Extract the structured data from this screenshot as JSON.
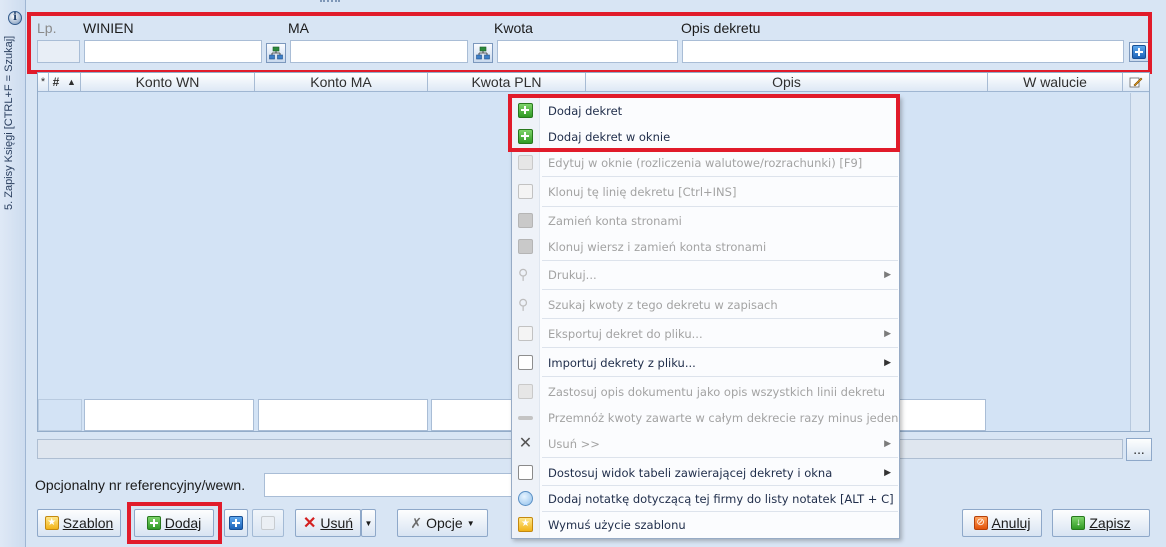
{
  "side_panel": {
    "label": "5. Zapisy Księgi [CTRL+F = Szukaj]"
  },
  "entry_header": {
    "lp_label": "Lp.",
    "winien_label": "WINIEN",
    "ma_label": "MA",
    "kwota_label": "Kwota",
    "opis_label": "Opis dekretu"
  },
  "grid": {
    "columns": [
      "*",
      "#",
      "▲",
      "Konto WN",
      "Konto MA",
      "Kwota PLN",
      "Opis",
      "W walucie"
    ]
  },
  "context_menu": {
    "items": [
      {
        "label": "Dodaj dekret",
        "enabled": true,
        "icon": "plus-green-icon"
      },
      {
        "label": "Dodaj dekret w oknie",
        "enabled": true,
        "icon": "plus-green-icon"
      },
      {
        "label": "Edytuj w oknie (rozliczenia walutowe/rozrachunki) [F9]",
        "enabled": false,
        "icon": "pencil-icon"
      },
      {
        "label": "Klonuj tę linię dekretu [Ctrl+INS]",
        "enabled": false,
        "icon": "clone-icon"
      },
      {
        "label": "Zamień konta stronami",
        "enabled": false,
        "icon": "swap-icon"
      },
      {
        "label": "Klonuj wiersz i zamień konta stronami",
        "enabled": false,
        "icon": "swap-icon"
      },
      {
        "label": "Drukuj...",
        "enabled": false,
        "icon": "magnifier-icon",
        "submenu": true
      },
      {
        "label": "Szukaj kwoty z tego dekretu w zapisach",
        "enabled": false,
        "icon": "magnifier-icon"
      },
      {
        "label": "Eksportuj dekret do pliku...",
        "enabled": false,
        "icon": "export-icon",
        "submenu": true
      },
      {
        "label": "Importuj dekrety z pliku...",
        "enabled": true,
        "icon": "import-icon",
        "submenu": true
      },
      {
        "label": "Zastosuj opis dokumentu jako opis wszystkich linii dekretu",
        "enabled": false,
        "icon": "description-icon"
      },
      {
        "label": "Przemnóż kwoty zawarte w całym dekrecie razy minus jeden",
        "enabled": false,
        "icon": "minus-icon"
      },
      {
        "label": "Usuń >>",
        "enabled": false,
        "icon": "close-icon",
        "submenu": true
      },
      {
        "label": "Dostosuj widok tabeli zawierającej dekrety i okna",
        "enabled": true,
        "icon": "layout-icon",
        "submenu": true
      },
      {
        "label": "Dodaj notatkę dotyczącą tej firmy do listy notatek [ALT + C]",
        "enabled": true,
        "icon": "note-bubble-icon"
      },
      {
        "label": "Wymuś użycie szablonu",
        "enabled": true,
        "icon": "star-icon"
      }
    ]
  },
  "reference": {
    "label": "Opcjonalny nr referencyjny/wewn."
  },
  "ellipsis_label": "...",
  "toolbar": {
    "szablon_label": "Szablon",
    "dodaj_label": "Dodaj",
    "usun_label": "Usuń",
    "opcje_label": "Opcje",
    "anuluj_label": "Anuluj",
    "zapisz_label": "Zapisz"
  },
  "colors": {
    "highlight_frame": "#e11b2a",
    "window_background": "#d8e5f4",
    "grid_background": "#d3e3f5"
  }
}
